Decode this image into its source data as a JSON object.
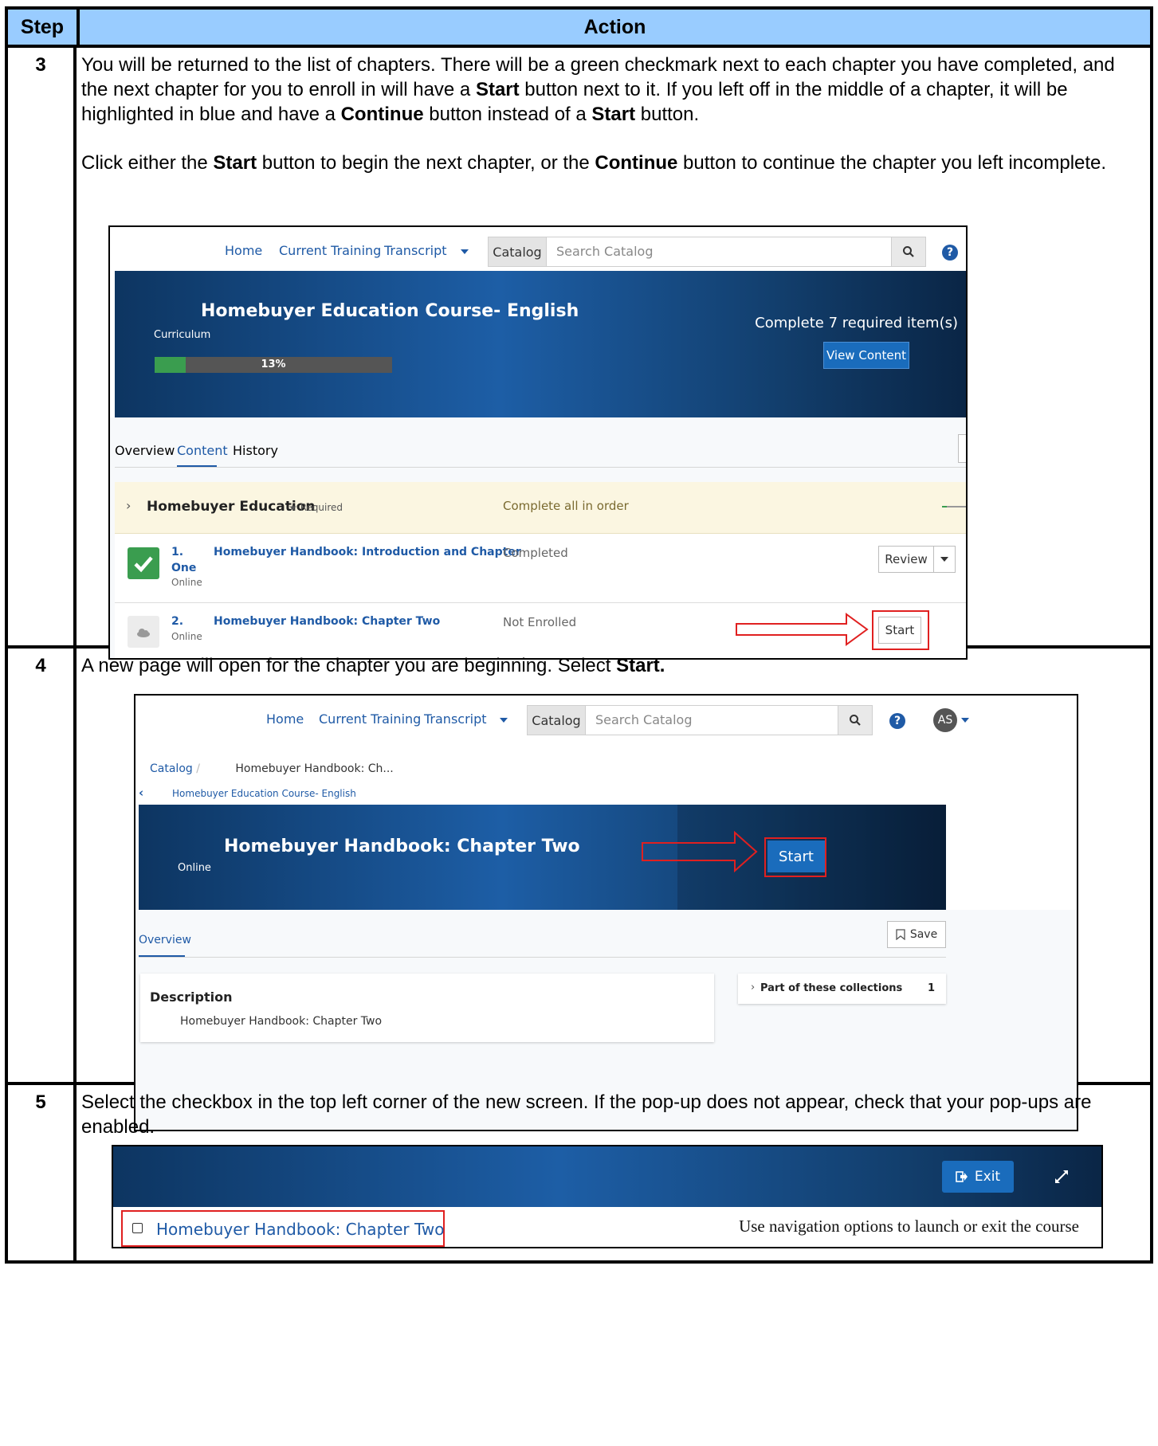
{
  "table": {
    "header_step": "Step",
    "header_action": "Action"
  },
  "steps": [
    {
      "number": "3",
      "para1": [
        {
          "t": "You will be returned to the list of chapters. There will be a green checkmark next to each chapter you have completed, and the next chapter for you to enroll in will have a "
        },
        {
          "t": "Start",
          "b": true
        },
        {
          "t": " button next to it. If you left off in the middle of a chapter, it will be highlighted in blue and have a "
        },
        {
          "t": "Continue",
          "b": true
        },
        {
          "t": " button instead of a "
        },
        {
          "t": "Start",
          "b": true
        },
        {
          "t": " button."
        }
      ],
      "para2": [
        {
          "t": "Click either the "
        },
        {
          "t": "Start",
          "b": true
        },
        {
          "t": " button to begin the next chapter, or the "
        },
        {
          "t": "Continue",
          "b": true
        },
        {
          "t": " button to continue the chapter you left incomplete."
        }
      ]
    },
    {
      "number": "4",
      "para1": [
        {
          "t": "A new page will open for the chapter you are beginning. Select "
        },
        {
          "t": "Start.",
          "b": true
        }
      ]
    },
    {
      "number": "5",
      "para1": [
        {
          "t": "Select the checkbox in the top left corner of the new screen. If the pop-up does not appear, check that your pop-ups are enabled."
        }
      ]
    }
  ],
  "nav": {
    "home": "Home",
    "current_training": "Current Training",
    "transcript": "Transcript",
    "catalog": "Catalog",
    "search_placeholder": "Search Catalog",
    "help_glyph": "?",
    "avatar": "AS"
  },
  "shot1": {
    "title": "Homebuyer Education Course- English",
    "type": "Curriculum",
    "progress_label": "13%",
    "progress_fraction": 0.13,
    "complete_text": "Complete 7 required item(s)",
    "view_content": "View Content",
    "tabs": [
      "Overview",
      "Content",
      "History"
    ],
    "section_title": "Homebuyer Education",
    "required": "Required",
    "section_rule": "Complete all in order",
    "items": [
      {
        "num": "1.",
        "title_line1": "Homebuyer Handbook: Introduction and Chapter",
        "title_line2": "One",
        "type": "Online",
        "status": "Completed",
        "action": "Review"
      },
      {
        "num": "2.",
        "title_line1": "Homebuyer Handbook: Chapter Two",
        "type": "Online",
        "status": "Not Enrolled",
        "action": "Start"
      }
    ]
  },
  "shot2": {
    "breadcrumb_root": "Catalog",
    "breadcrumb_sep": "/",
    "breadcrumb_current": "Homebuyer Handbook: Ch...",
    "back_link": "Homebuyer Education Course- English",
    "title": "Homebuyer Handbook: Chapter Two",
    "type": "Online",
    "start": "Start",
    "tab_overview": "Overview",
    "save": "Save",
    "description_heading": "Description",
    "description_text": "Homebuyer Handbook: Chapter Two",
    "collections_label": "Part of these collections",
    "collections_count": "1"
  },
  "shot3": {
    "exit": "Exit",
    "course_title": "Homebuyer Handbook: Chapter Two",
    "nav_hint": "Use navigation options to launch or exit the course"
  },
  "colors": {
    "header_bg": "#99ccff",
    "banner_blue": "#1d5ea6",
    "link_blue": "#1f5aa6",
    "button_blue": "#1a6cbc",
    "highlight_red": "#e02020",
    "check_green": "#3a9d4f",
    "required_band": "#fbf6e1"
  }
}
